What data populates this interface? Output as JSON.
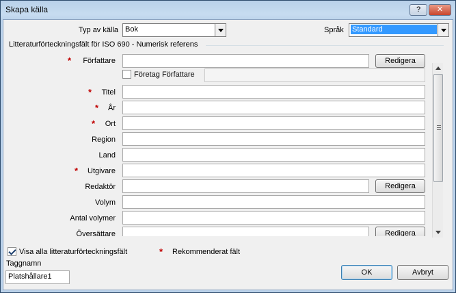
{
  "window": {
    "title": "Skapa källa"
  },
  "titlebar": {
    "help_label": "?",
    "close_label": "✕"
  },
  "source_type": {
    "label": "Typ av källa",
    "value": "Bok"
  },
  "language": {
    "label": "Språk",
    "value": "Standard"
  },
  "group_title": "Litteraturförteckningsfält för ISO 690 - Numerisk referens",
  "fields": {
    "author": {
      "label": "Författare",
      "value": "",
      "edit_label": "Redigera"
    },
    "corporate_author": {
      "label": "Företag Författare",
      "checked": false,
      "value": ""
    },
    "title": {
      "label": "Titel",
      "value": ""
    },
    "year": {
      "label": "År",
      "value": ""
    },
    "city": {
      "label": "Ort",
      "value": ""
    },
    "region": {
      "label": "Region",
      "value": ""
    },
    "country": {
      "label": "Land",
      "value": ""
    },
    "publisher": {
      "label": "Utgivare",
      "value": ""
    },
    "editor": {
      "label": "Redaktör",
      "value": "",
      "edit_label": "Redigera"
    },
    "volume": {
      "label": "Volym",
      "value": ""
    },
    "num_volumes": {
      "label": "Antal volymer",
      "value": ""
    },
    "translator": {
      "label": "Översättare",
      "value": "",
      "edit_label": "Redigera"
    }
  },
  "required_marker": "*",
  "show_all": {
    "label": "Visa alla litteraturförteckningsfält",
    "checked": true
  },
  "legend": {
    "marker": "*",
    "label": "Rekommenderat fält"
  },
  "tag": {
    "label": "Taggnamn",
    "value": "Platshållare1"
  },
  "buttons": {
    "ok": "OK",
    "cancel": "Avbryt"
  }
}
